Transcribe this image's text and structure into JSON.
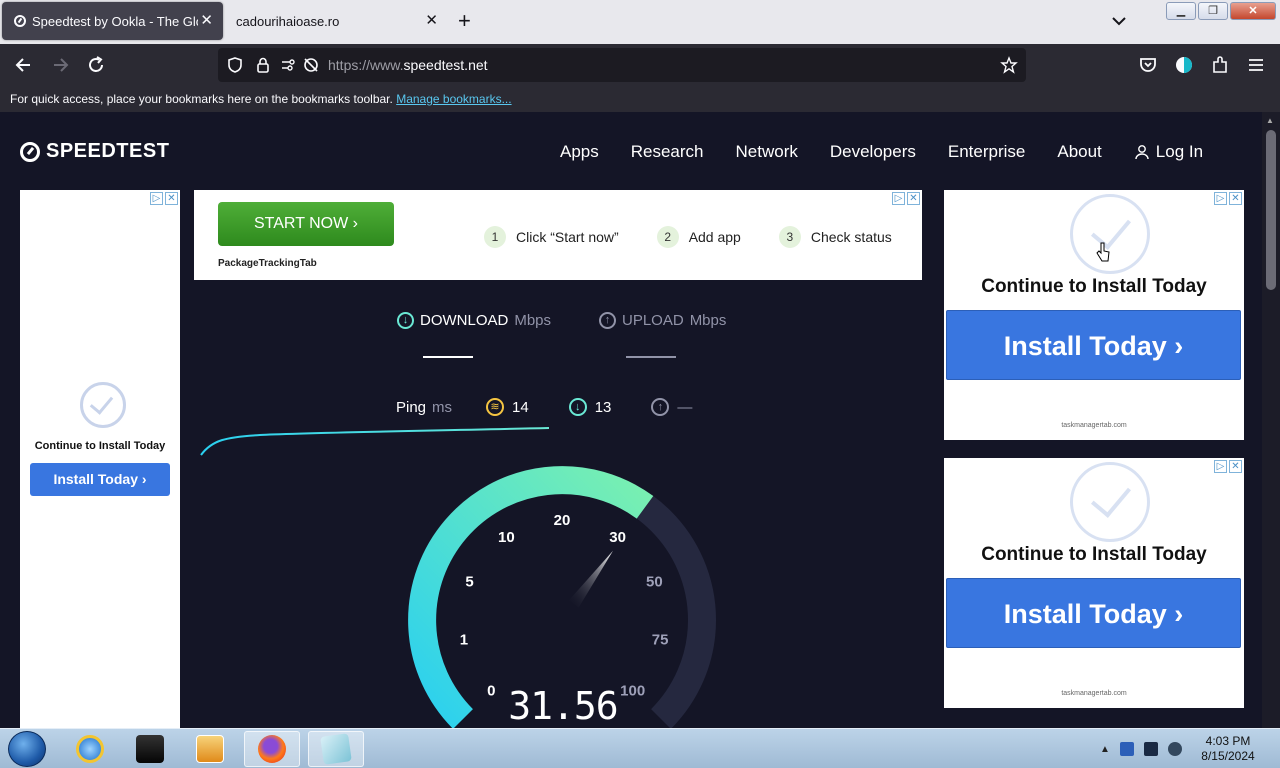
{
  "browser": {
    "tabs": [
      {
        "title": "Speedtest by Ookla - The Global",
        "close": "✕"
      },
      {
        "title": "cadourihaioase.ro",
        "close": "✕"
      }
    ],
    "new_tab": "+",
    "url_scheme": "https://www.",
    "url_host": "speedtest.net",
    "bookmarks_hint": "For quick access, place your bookmarks here on the bookmarks toolbar.",
    "manage_bookmarks": "Manage bookmarks..."
  },
  "site": {
    "logo": "SPEEDTEST",
    "nav": [
      "Apps",
      "Research",
      "Network",
      "Developers",
      "Enterprise",
      "About"
    ],
    "login": "Log In"
  },
  "ads": {
    "top": {
      "cta": "START NOW  ›",
      "brand": "PackageTrackingTab",
      "steps": [
        {
          "n": "1",
          "label": "Click “Start now”"
        },
        {
          "n": "2",
          "label": "Add app"
        },
        {
          "n": "3",
          "label": "Check status"
        }
      ]
    },
    "left": {
      "headline": "Continue to Install Today",
      "button": "Install Today  ›"
    },
    "right": [
      {
        "headline": "Continue to Install Today",
        "button": "Install Today  ›",
        "domain": "taskmanagertab.com"
      },
      {
        "headline": "Continue to Install Today",
        "button": "Install Today  ›",
        "domain": "taskmanagertab.com"
      }
    ]
  },
  "speedtest": {
    "download_label": "DOWNLOAD",
    "upload_label": "UPLOAD",
    "unit": "Mbps",
    "ping_label": "Ping",
    "ping_unit": "ms",
    "ping_value": "14",
    "download_latency": "13",
    "upload_latency": "—",
    "gauge_ticks": [
      "0",
      "1",
      "5",
      "10",
      "20",
      "30",
      "50",
      "75",
      "100"
    ],
    "current_speed": "31.56",
    "needle_value": 31.56
  },
  "taskbar": {
    "time": "4:03 PM",
    "date": "8/15/2024"
  },
  "colors": {
    "page_bg": "#141526",
    "accent_teal": "#6ae8d4",
    "gauge_start": "#2ad0f0",
    "gauge_end": "#7af0b0",
    "ad_blue": "#3976e0",
    "ad_green": "#3a9a28"
  }
}
